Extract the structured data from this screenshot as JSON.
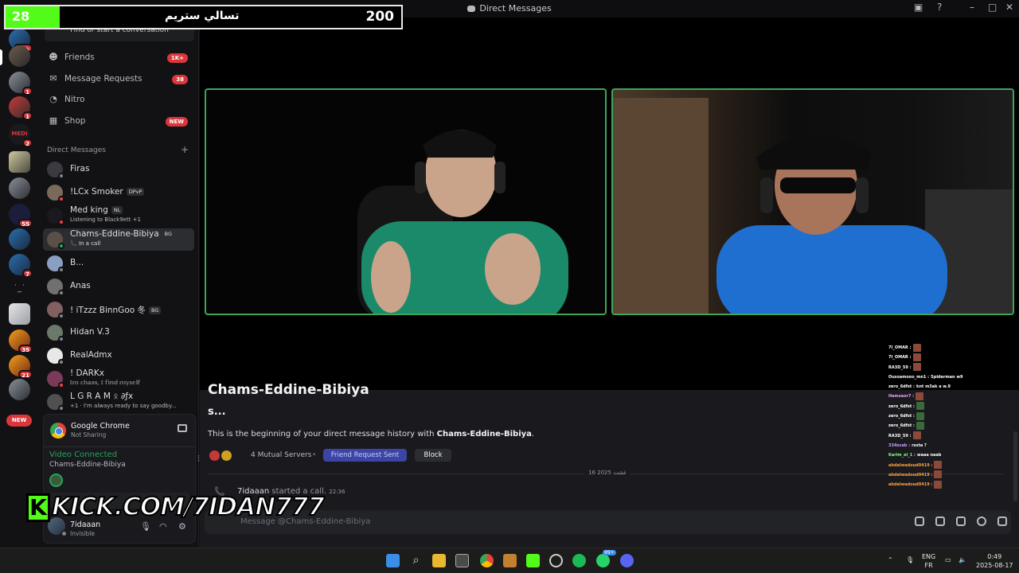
{
  "window": {
    "title": "Direct Messages"
  },
  "stream_overlay": {
    "viewer_count": "28",
    "title": "تسالي ستريم",
    "goal": "200",
    "kick_url": "KICK.COM/7IDAN777",
    "kick_letter": "K"
  },
  "rail": {
    "badges": [
      "1K+",
      "1",
      "1",
      "2",
      "55",
      "7",
      "35",
      "21"
    ],
    "labels": {
      "medi": "MEDI",
      "new": "NEW"
    }
  },
  "search": {
    "placeholder": "Find or start a conversation"
  },
  "nav": [
    {
      "label": "Friends",
      "badge": "1K+"
    },
    {
      "label": "Message Requests",
      "badge": "38"
    },
    {
      "label": "Nitro",
      "badge": ""
    },
    {
      "label": "Shop",
      "badge": "NEW"
    }
  ],
  "dm_header": "Direct Messages",
  "dms": [
    {
      "name": "Firas",
      "tag": "",
      "sub": ""
    },
    {
      "name": "!LCx Smoker",
      "tag": "DPvP",
      "sub": ""
    },
    {
      "name": "Med king",
      "tag": "NL",
      "sub": "Listening to Black9ett +1"
    },
    {
      "name": "Chams-Eddine-Bibiya",
      "tag": "BG",
      "sub": "In a call"
    },
    {
      "name": "B...",
      "tag": "",
      "sub": ""
    },
    {
      "name": "Anas",
      "tag": "",
      "sub": ""
    },
    {
      "name": "! iTzzz BinnGoo 冬",
      "tag": "BG",
      "sub": ""
    },
    {
      "name": "Hidan V.3",
      "tag": "",
      "sub": ""
    },
    {
      "name": "RealAdmx",
      "tag": "",
      "sub": ""
    },
    {
      "name": "! DARKx",
      "tag": "",
      "sub": "𝕀𝕞 𝕔𝕙𝕒𝕠𝕤, 𝕀 𝕗𝕚𝕟𝕕 𝕞𝕪𝕤𝕖𝕝𝕗"
    },
    {
      "name": "L G R A M ᛟ ∂ƒx",
      "tag": "",
      "sub": "+1 · I'm always ready to say goodby..."
    }
  ],
  "voice": {
    "app_name": "Google Chrome",
    "app_status": "Not Sharing",
    "status": "Video Connected",
    "channel": "Chams-Eddine-Bibiya"
  },
  "user": {
    "name": "7idaaan",
    "status": "Invisible"
  },
  "chat": {
    "heading": "Chams-Eddine-Bibiya",
    "subheading": "s...",
    "intro_prefix": "This is the beginning of your direct message history with ",
    "intro_name": "Chams-Eddine-Bibiya",
    "intro_suffix": ".",
    "mutual": "4 Mutual Servers",
    "friend_request": "Friend Request Sent",
    "block": "Block",
    "divider_date": "16 غشت 2025",
    "call_user": "7idaaan",
    "call_text": " started a call.",
    "call_time": "22:36",
    "input_placeholder": "Message @Chams-Eddine-Bibiya"
  },
  "kick_chat": [
    {
      "user": "7I_OMAR :",
      "msg": "",
      "emote": true,
      "color": "#ffffff"
    },
    {
      "user": "7I_OMAR :",
      "msg": "",
      "emote": true,
      "color": "#ffffff"
    },
    {
      "user": "RA3D_59 :",
      "msg": "",
      "emote": true,
      "color": "#ffffff"
    },
    {
      "user": "Oussamooo_mn1 :",
      "msg": "Spiderman w9",
      "emote": false,
      "color": "#ffffff"
    },
    {
      "user": "zero_6dfst :",
      "msg": "knt m3ak a w.9",
      "emote": false,
      "color": "#ffffff"
    },
    {
      "user": "Hamzaor7 :",
      "msg": "",
      "emote": true,
      "color": "#e8a0ff"
    },
    {
      "user": "zero_6dfst :",
      "msg": "",
      "emote": true,
      "color": "#ffffff"
    },
    {
      "user": "zero_6dfst :",
      "msg": "",
      "emote": true,
      "color": "#ffffff"
    },
    {
      "user": "zero_6dfst :",
      "msg": "",
      "emote": true,
      "color": "#ffffff"
    },
    {
      "user": "RA3D_59 :",
      "msg": "",
      "emote": true,
      "color": "#ffffff"
    },
    {
      "user": "334scab :",
      "msg": "rssta ?",
      "emote": false,
      "color": "#c9a0ff"
    },
    {
      "user": "Karim_el_1 :",
      "msg": "waaa naab",
      "emote": false,
      "color": "#7fff7f"
    },
    {
      "user": "abdalwadoud0419 :",
      "msg": "",
      "emote": true,
      "color": "#ffa040"
    },
    {
      "user": "abdalwadoud0419 :",
      "msg": "",
      "emote": true,
      "color": "#ffa040"
    },
    {
      "user": "abdalwadoud0419 :",
      "msg": "",
      "emote": true,
      "color": "#ffa040"
    }
  ],
  "taskbar": {
    "lang_top": "ENG",
    "lang_bottom": "FR",
    "time": "0:49",
    "date": "2025-08-17",
    "whatsapp_badge": "99+"
  },
  "colors": {
    "kick_green": "#53fc18",
    "discord_red": "#da373c",
    "online_green": "#23a55a",
    "tile_border": "#3fa55a",
    "blurple": "#3c45a5"
  }
}
